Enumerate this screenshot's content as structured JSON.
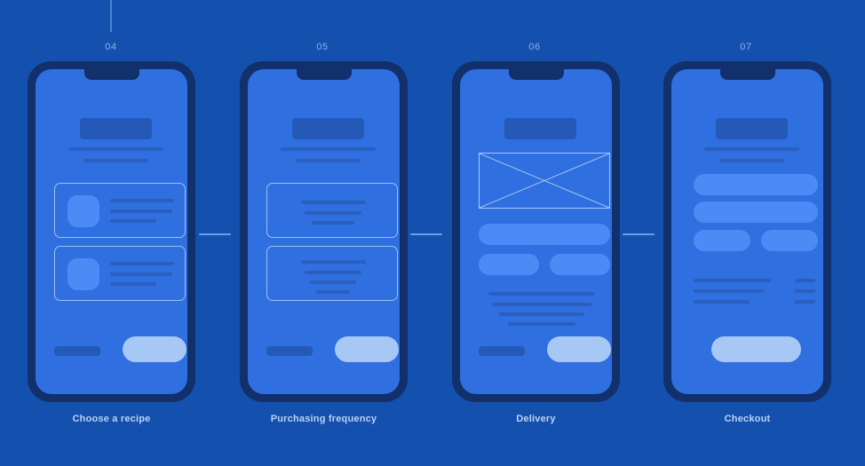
{
  "background_color": "#1450ae",
  "theme": {
    "frame_color": "#12306b",
    "screen_color": "#2f6fdf",
    "line_color": "#2a5fc0",
    "bar_color": "#2459b8",
    "accent_pill": "#4b8bf5",
    "cta_color": "#a7c8f5",
    "outline_color": "#9cc0f0",
    "label_color": "#b9d2f2",
    "step_color": "#8fb2e6",
    "connector_color": "#6e9ee0"
  },
  "flow": {
    "steps": [
      {
        "number": "04",
        "caption": "Choose a recipe",
        "screen_type": "list-with-thumbnails",
        "elements": [
          "title-bar",
          "subtitle-line-long",
          "subtitle-line-short",
          "recipe-card-1",
          "recipe-card-2",
          "footer-label",
          "primary-cta"
        ]
      },
      {
        "number": "05",
        "caption": "Purchasing frequency",
        "screen_type": "option-cards-centered",
        "elements": [
          "title-bar",
          "subtitle-line-long",
          "subtitle-line-short",
          "frequency-option-card-1",
          "frequency-option-card-2",
          "footer-label",
          "primary-cta"
        ]
      },
      {
        "number": "06",
        "caption": "Delivery",
        "screen_type": "map-and-options",
        "elements": [
          "title-bar",
          "map-image-placeholder",
          "address-field",
          "option-pill-left",
          "option-pill-right",
          "summary-lines",
          "footer-label",
          "primary-cta"
        ]
      },
      {
        "number": "07",
        "caption": "Checkout",
        "screen_type": "form-and-summary",
        "elements": [
          "title-bar",
          "subtitle-line-long",
          "subtitle-line-short",
          "input-field-1",
          "input-field-2",
          "input-field-half-left",
          "input-field-half-right",
          "summary-lines",
          "price-lines",
          "primary-cta-wide"
        ]
      }
    ],
    "connectors": 3,
    "top_tick_step": "04"
  }
}
